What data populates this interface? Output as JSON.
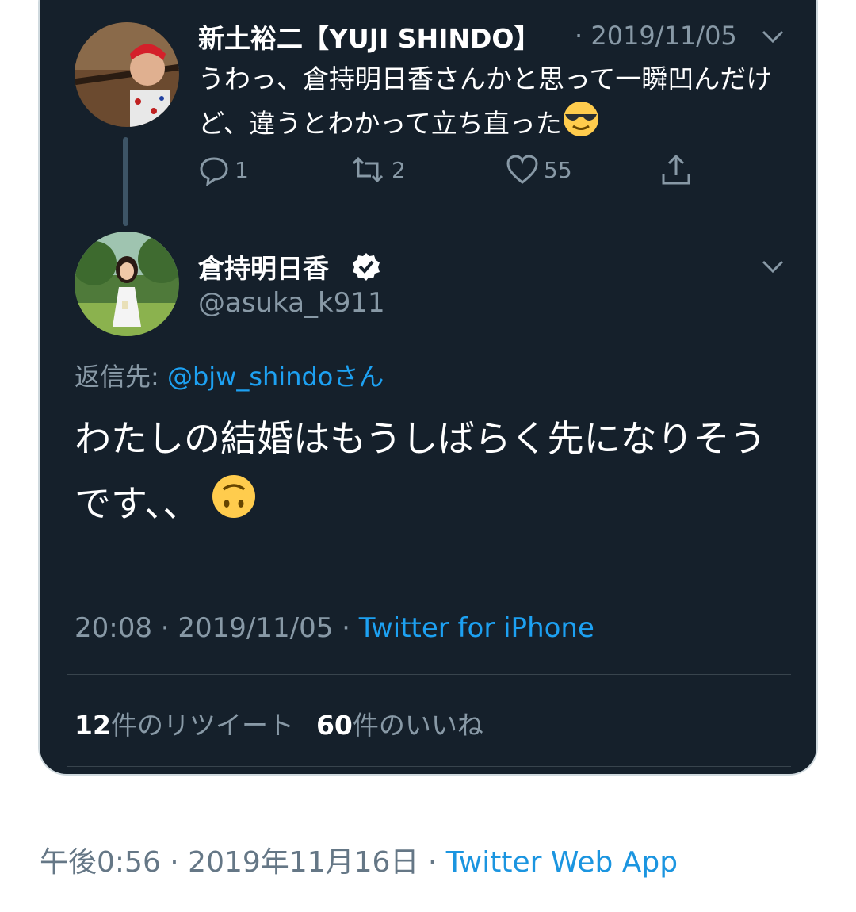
{
  "reply_tweet": {
    "author_name": "新土裕二【YUJI SHINDO】",
    "date": "· 2019/11/05",
    "text": "うわっ、倉持明日香さんかと思って一瞬凹んだけど、違うとわかって立ち直った",
    "emoji": "smiling-face-with-sunglasses",
    "reply_count": "1",
    "retweet_count": "2",
    "like_count": "55"
  },
  "main_tweet": {
    "author_name": "倉持明日香",
    "handle": "@asuka_k911",
    "reply_label": "返信先: ",
    "reply_mention": "@bjw_shindo",
    "reply_suffix": "さん",
    "text": "わたしの結婚はもうしばらく先になりそうです、、",
    "emoji": "upside-down-face",
    "time_date": "20:08 · 2019/11/05 · ",
    "source": "Twitter for iPhone",
    "retweets_num": "12",
    "retweets_label": "件のリツイート",
    "likes_num": "60",
    "likes_label": "件のいいね"
  },
  "footer": {
    "timestamp": "午後0:56 · 2019年11月16日 · ",
    "source": "Twitter Web App"
  },
  "colors": {
    "card_bg": "#15202b",
    "muted_text": "#8899a6",
    "link": "#1da1f2"
  }
}
